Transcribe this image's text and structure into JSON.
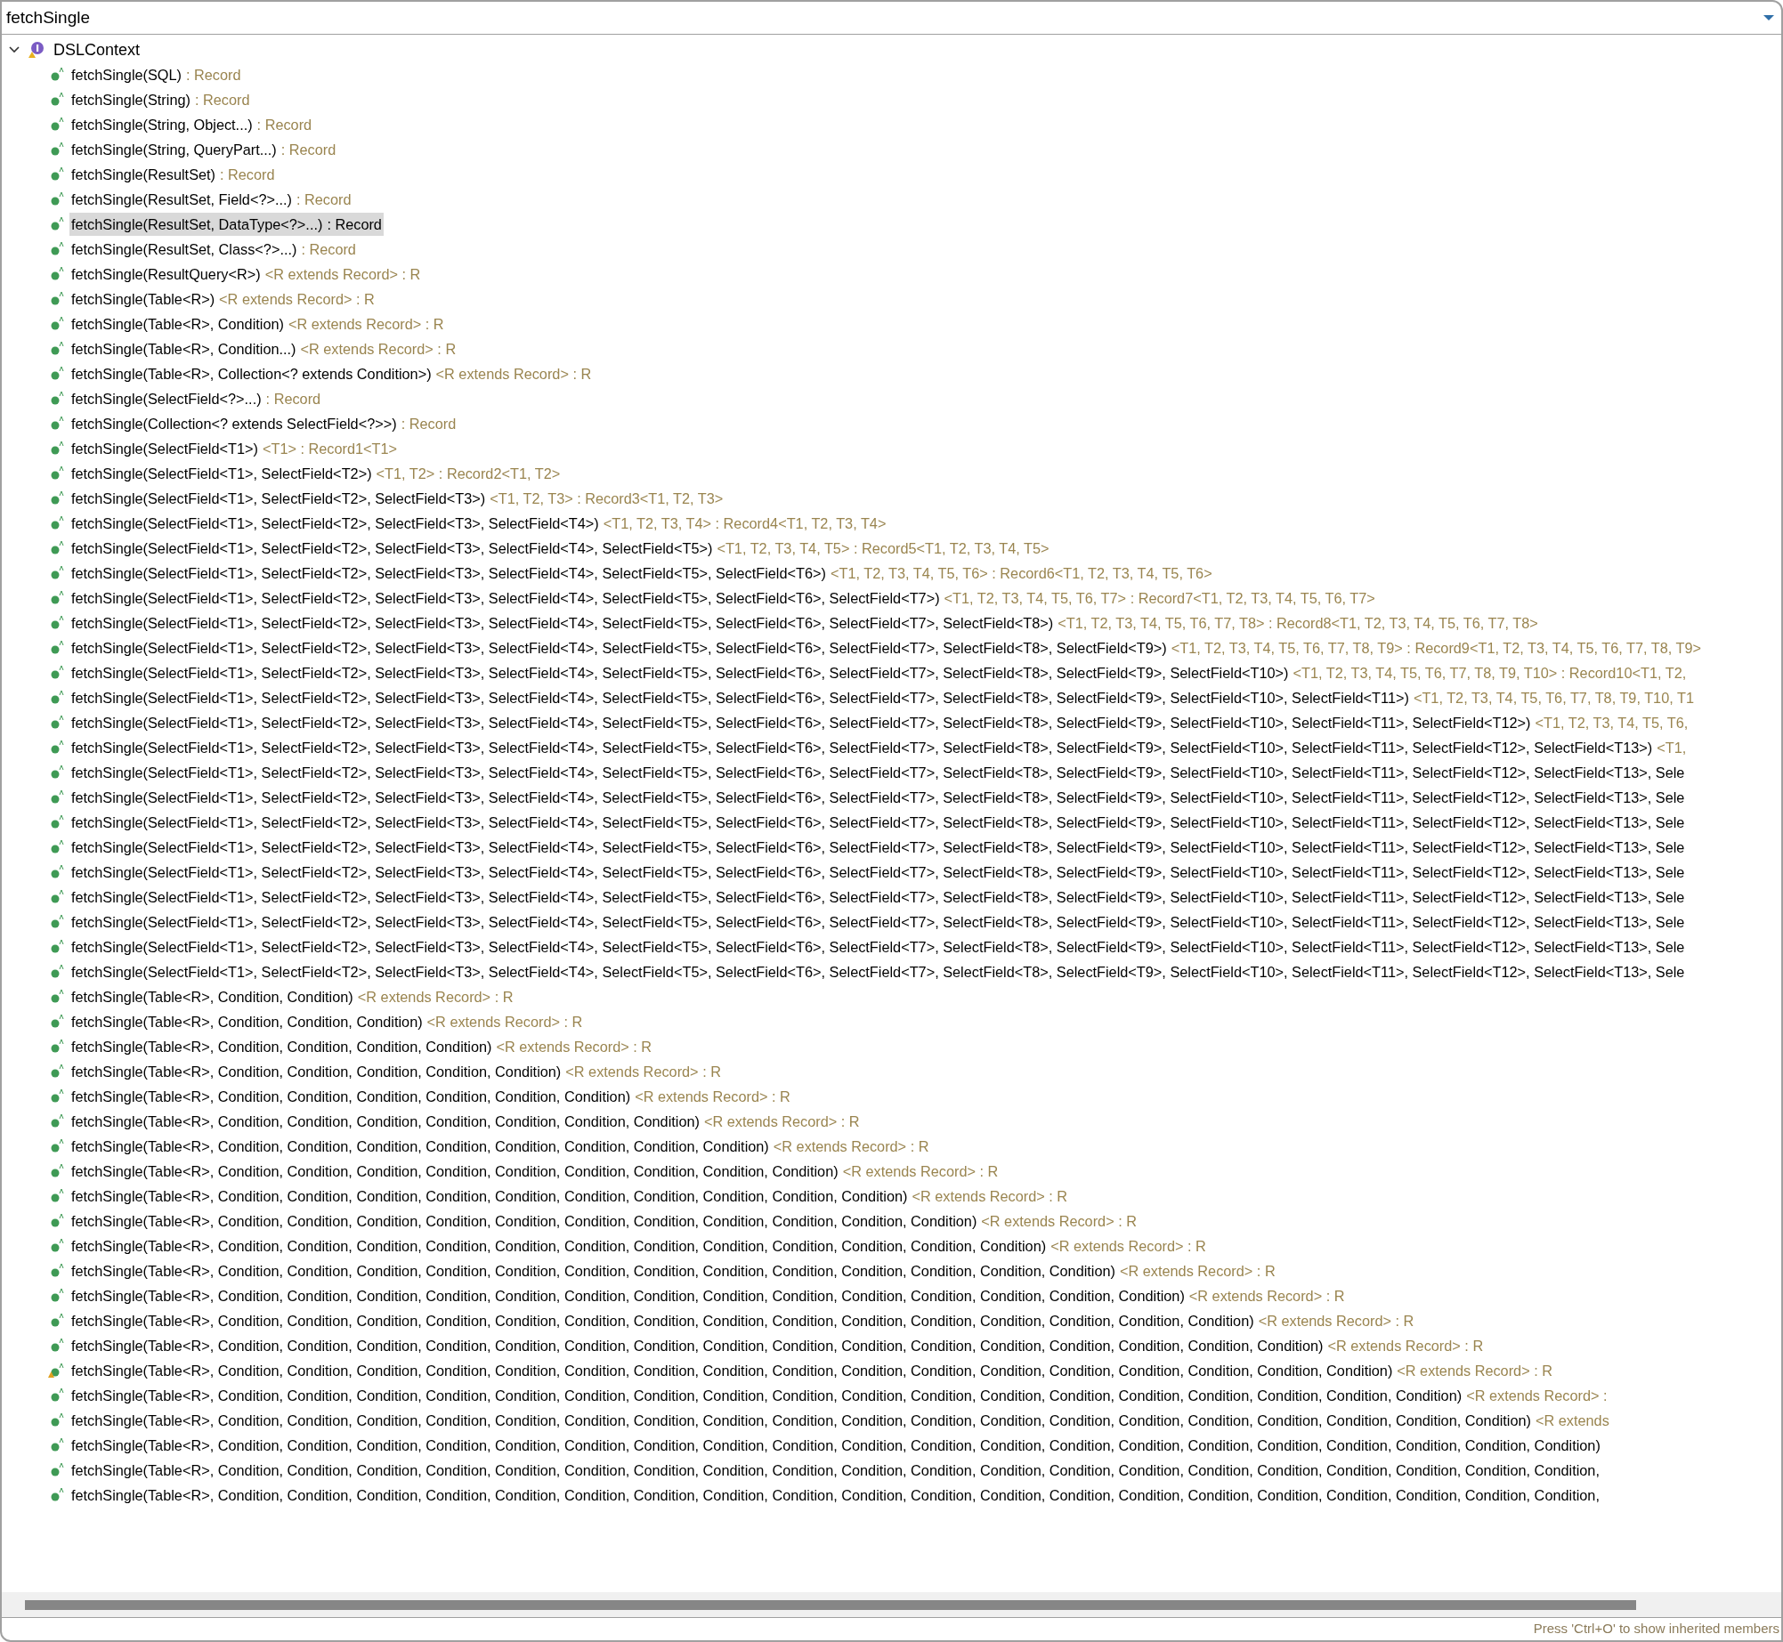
{
  "filter": {
    "value": "fetchSingle"
  },
  "tree": [
    {
      "label": "DSLContext",
      "expanded": true,
      "children": [
        {
          "signature": "fetchSingle(SQL)",
          "return_type": ": Record",
          "selected": false,
          "warning": false
        },
        {
          "signature": "fetchSingle(String)",
          "return_type": ": Record",
          "selected": false,
          "warning": false
        },
        {
          "signature": "fetchSingle(String, Object...)",
          "return_type": ": Record",
          "selected": false,
          "warning": false
        },
        {
          "signature": "fetchSingle(String, QueryPart...)",
          "return_type": ": Record",
          "selected": false,
          "warning": false
        },
        {
          "signature": "fetchSingle(ResultSet)",
          "return_type": ": Record",
          "selected": false,
          "warning": false
        },
        {
          "signature": "fetchSingle(ResultSet, Field<?>...)",
          "return_type": ": Record",
          "selected": false,
          "warning": false
        },
        {
          "signature": "fetchSingle(ResultSet, DataType<?>...)",
          "return_type": ": Record",
          "selected": true,
          "warning": false
        },
        {
          "signature": "fetchSingle(ResultSet, Class<?>...)",
          "return_type": ": Record",
          "selected": false,
          "warning": false
        },
        {
          "signature": "fetchSingle(ResultQuery<R>)",
          "return_type": "<R extends Record> : R",
          "selected": false,
          "warning": false
        },
        {
          "signature": "fetchSingle(Table<R>)",
          "return_type": "<R extends Record> : R",
          "selected": false,
          "warning": false
        },
        {
          "signature": "fetchSingle(Table<R>, Condition)",
          "return_type": "<R extends Record> : R",
          "selected": false,
          "warning": false
        },
        {
          "signature": "fetchSingle(Table<R>, Condition...)",
          "return_type": "<R extends Record> : R",
          "selected": false,
          "warning": false
        },
        {
          "signature": "fetchSingle(Table<R>, Collection<? extends Condition>)",
          "return_type": "<R extends Record> : R",
          "selected": false,
          "warning": false
        },
        {
          "signature": "fetchSingle(SelectField<?>...)",
          "return_type": ": Record",
          "selected": false,
          "warning": false
        },
        {
          "signature": "fetchSingle(Collection<? extends SelectField<?>>)",
          "return_type": ": Record",
          "selected": false,
          "warning": false
        },
        {
          "signature": "fetchSingle(SelectField<T1>)",
          "return_type": "<T1> : Record1<T1>",
          "selected": false,
          "warning": false
        },
        {
          "signature": "fetchSingle(SelectField<T1>, SelectField<T2>)",
          "return_type": "<T1, T2> : Record2<T1, T2>",
          "selected": false,
          "warning": false
        },
        {
          "signature": "fetchSingle(SelectField<T1>, SelectField<T2>, SelectField<T3>)",
          "return_type": "<T1, T2, T3> : Record3<T1, T2, T3>",
          "selected": false,
          "warning": false
        },
        {
          "signature": "fetchSingle(SelectField<T1>, SelectField<T2>, SelectField<T3>, SelectField<T4>)",
          "return_type": "<T1, T2, T3, T4> : Record4<T1, T2, T3, T4>",
          "selected": false,
          "warning": false
        },
        {
          "signature": "fetchSingle(SelectField<T1>, SelectField<T2>, SelectField<T3>, SelectField<T4>, SelectField<T5>)",
          "return_type": "<T1, T2, T3, T4, T5> : Record5<T1, T2, T3, T4, T5>",
          "selected": false,
          "warning": false
        },
        {
          "signature": "fetchSingle(SelectField<T1>, SelectField<T2>, SelectField<T3>, SelectField<T4>, SelectField<T5>, SelectField<T6>)",
          "return_type": "<T1, T2, T3, T4, T5, T6> : Record6<T1, T2, T3, T4, T5, T6>",
          "selected": false,
          "warning": false
        },
        {
          "signature": "fetchSingle(SelectField<T1>, SelectField<T2>, SelectField<T3>, SelectField<T4>, SelectField<T5>, SelectField<T6>, SelectField<T7>)",
          "return_type": "<T1, T2, T3, T4, T5, T6, T7> : Record7<T1, T2, T3, T4, T5, T6, T7>",
          "selected": false,
          "warning": false
        },
        {
          "signature": "fetchSingle(SelectField<T1>, SelectField<T2>, SelectField<T3>, SelectField<T4>, SelectField<T5>, SelectField<T6>, SelectField<T7>, SelectField<T8>)",
          "return_type": "<T1, T2, T3, T4, T5, T6, T7, T8> : Record8<T1, T2, T3, T4, T5, T6, T7, T8>",
          "selected": false,
          "warning": false
        },
        {
          "signature": "fetchSingle(SelectField<T1>, SelectField<T2>, SelectField<T3>, SelectField<T4>, SelectField<T5>, SelectField<T6>, SelectField<T7>, SelectField<T8>, SelectField<T9>)",
          "return_type": "<T1, T2, T3, T4, T5, T6, T7, T8, T9> : Record9<T1, T2, T3, T4, T5, T6, T7, T8, T9>",
          "selected": false,
          "warning": false
        },
        {
          "signature": "fetchSingle(SelectField<T1>, SelectField<T2>, SelectField<T3>, SelectField<T4>, SelectField<T5>, SelectField<T6>, SelectField<T7>, SelectField<T8>, SelectField<T9>, SelectField<T10>)",
          "return_type": "<T1, T2, T3, T4, T5, T6, T7, T8, T9, T10> : Record10<T1, T2,",
          "selected": false,
          "warning": false
        },
        {
          "signature": "fetchSingle(SelectField<T1>, SelectField<T2>, SelectField<T3>, SelectField<T4>, SelectField<T5>, SelectField<T6>, SelectField<T7>, SelectField<T8>, SelectField<T9>, SelectField<T10>, SelectField<T11>)",
          "return_type": "<T1, T2, T3, T4, T5, T6, T7, T8, T9, T10, T1",
          "selected": false,
          "warning": false
        },
        {
          "signature": "fetchSingle(SelectField<T1>, SelectField<T2>, SelectField<T3>, SelectField<T4>, SelectField<T5>, SelectField<T6>, SelectField<T7>, SelectField<T8>, SelectField<T9>, SelectField<T10>, SelectField<T11>, SelectField<T12>)",
          "return_type": "<T1, T2, T3, T4, T5, T6,",
          "selected": false,
          "warning": false
        },
        {
          "signature": "fetchSingle(SelectField<T1>, SelectField<T2>, SelectField<T3>, SelectField<T4>, SelectField<T5>, SelectField<T6>, SelectField<T7>, SelectField<T8>, SelectField<T9>, SelectField<T10>, SelectField<T11>, SelectField<T12>, SelectField<T13>)",
          "return_type": "<T1,",
          "selected": false,
          "warning": false
        },
        {
          "signature": "fetchSingle(SelectField<T1>, SelectField<T2>, SelectField<T3>, SelectField<T4>, SelectField<T5>, SelectField<T6>, SelectField<T7>, SelectField<T8>, SelectField<T9>, SelectField<T10>, SelectField<T11>, SelectField<T12>, SelectField<T13>, Sele",
          "selected": false,
          "warning": false
        },
        {
          "signature": "fetchSingle(SelectField<T1>, SelectField<T2>, SelectField<T3>, SelectField<T4>, SelectField<T5>, SelectField<T6>, SelectField<T7>, SelectField<T8>, SelectField<T9>, SelectField<T10>, SelectField<T11>, SelectField<T12>, SelectField<T13>, Sele",
          "selected": false,
          "warning": false
        },
        {
          "signature": "fetchSingle(SelectField<T1>, SelectField<T2>, SelectField<T3>, SelectField<T4>, SelectField<T5>, SelectField<T6>, SelectField<T7>, SelectField<T8>, SelectField<T9>, SelectField<T10>, SelectField<T11>, SelectField<T12>, SelectField<T13>, Sele",
          "selected": false,
          "warning": false
        },
        {
          "signature": "fetchSingle(SelectField<T1>, SelectField<T2>, SelectField<T3>, SelectField<T4>, SelectField<T5>, SelectField<T6>, SelectField<T7>, SelectField<T8>, SelectField<T9>, SelectField<T10>, SelectField<T11>, SelectField<T12>, SelectField<T13>, Sele",
          "selected": false,
          "warning": false
        },
        {
          "signature": "fetchSingle(SelectField<T1>, SelectField<T2>, SelectField<T3>, SelectField<T4>, SelectField<T5>, SelectField<T6>, SelectField<T7>, SelectField<T8>, SelectField<T9>, SelectField<T10>, SelectField<T11>, SelectField<T12>, SelectField<T13>, Sele",
          "selected": false,
          "warning": false
        },
        {
          "signature": "fetchSingle(SelectField<T1>, SelectField<T2>, SelectField<T3>, SelectField<T4>, SelectField<T5>, SelectField<T6>, SelectField<T7>, SelectField<T8>, SelectField<T9>, SelectField<T10>, SelectField<T11>, SelectField<T12>, SelectField<T13>, Sele",
          "selected": false,
          "warning": false
        },
        {
          "signature": "fetchSingle(SelectField<T1>, SelectField<T2>, SelectField<T3>, SelectField<T4>, SelectField<T5>, SelectField<T6>, SelectField<T7>, SelectField<T8>, SelectField<T9>, SelectField<T10>, SelectField<T11>, SelectField<T12>, SelectField<T13>, Sele",
          "selected": false,
          "warning": false
        },
        {
          "signature": "fetchSingle(SelectField<T1>, SelectField<T2>, SelectField<T3>, SelectField<T4>, SelectField<T5>, SelectField<T6>, SelectField<T7>, SelectField<T8>, SelectField<T9>, SelectField<T10>, SelectField<T11>, SelectField<T12>, SelectField<T13>, Sele",
          "selected": false,
          "warning": false
        },
        {
          "signature": "fetchSingle(SelectField<T1>, SelectField<T2>, SelectField<T3>, SelectField<T4>, SelectField<T5>, SelectField<T6>, SelectField<T7>, SelectField<T8>, SelectField<T9>, SelectField<T10>, SelectField<T11>, SelectField<T12>, SelectField<T13>, Sele",
          "selected": false,
          "warning": false
        },
        {
          "signature": "fetchSingle(Table<R>, Condition, Condition)",
          "return_type": "<R extends Record> : R",
          "selected": false,
          "warning": false
        },
        {
          "signature": "fetchSingle(Table<R>, Condition, Condition, Condition)",
          "return_type": "<R extends Record> : R",
          "selected": false,
          "warning": false
        },
        {
          "signature": "fetchSingle(Table<R>, Condition, Condition, Condition, Condition)",
          "return_type": "<R extends Record> : R",
          "selected": false,
          "warning": false
        },
        {
          "signature": "fetchSingle(Table<R>, Condition, Condition, Condition, Condition, Condition)",
          "return_type": "<R extends Record> : R",
          "selected": false,
          "warning": false
        },
        {
          "signature": "fetchSingle(Table<R>, Condition, Condition, Condition, Condition, Condition, Condition)",
          "return_type": "<R extends Record> : R",
          "selected": false,
          "warning": false
        },
        {
          "signature": "fetchSingle(Table<R>, Condition, Condition, Condition, Condition, Condition, Condition, Condition)",
          "return_type": "<R extends Record> : R",
          "selected": false,
          "warning": false
        },
        {
          "signature": "fetchSingle(Table<R>, Condition, Condition, Condition, Condition, Condition, Condition, Condition, Condition)",
          "return_type": "<R extends Record> : R",
          "selected": false,
          "warning": false
        },
        {
          "signature": "fetchSingle(Table<R>, Condition, Condition, Condition, Condition, Condition, Condition, Condition, Condition, Condition)",
          "return_type": "<R extends Record> : R",
          "selected": false,
          "warning": false
        },
        {
          "signature": "fetchSingle(Table<R>, Condition, Condition, Condition, Condition, Condition, Condition, Condition, Condition, Condition, Condition)",
          "return_type": "<R extends Record> : R",
          "selected": false,
          "warning": false
        },
        {
          "signature": "fetchSingle(Table<R>, Condition, Condition, Condition, Condition, Condition, Condition, Condition, Condition, Condition, Condition, Condition)",
          "return_type": "<R extends Record> : R",
          "selected": false,
          "warning": false
        },
        {
          "signature": "fetchSingle(Table<R>, Condition, Condition, Condition, Condition, Condition, Condition, Condition, Condition, Condition, Condition, Condition, Condition)",
          "return_type": "<R extends Record> : R",
          "selected": false,
          "warning": false
        },
        {
          "signature": "fetchSingle(Table<R>, Condition, Condition, Condition, Condition, Condition, Condition, Condition, Condition, Condition, Condition, Condition, Condition, Condition)",
          "return_type": "<R extends Record> : R",
          "selected": false,
          "warning": false
        },
        {
          "signature": "fetchSingle(Table<R>, Condition, Condition, Condition, Condition, Condition, Condition, Condition, Condition, Condition, Condition, Condition, Condition, Condition, Condition)",
          "return_type": "<R extends Record> : R",
          "selected": false,
          "warning": false
        },
        {
          "signature": "fetchSingle(Table<R>, Condition, Condition, Condition, Condition, Condition, Condition, Condition, Condition, Condition, Condition, Condition, Condition, Condition, Condition, Condition)",
          "return_type": "<R extends Record> : R",
          "selected": false,
          "warning": false
        },
        {
          "signature": "fetchSingle(Table<R>, Condition, Condition, Condition, Condition, Condition, Condition, Condition, Condition, Condition, Condition, Condition, Condition, Condition, Condition, Condition, Condition)",
          "return_type": "<R extends Record> : R",
          "selected": false,
          "warning": false
        },
        {
          "signature": "fetchSingle(Table<R>, Condition, Condition, Condition, Condition, Condition, Condition, Condition, Condition, Condition, Condition, Condition, Condition, Condition, Condition, Condition, Condition, Condition)",
          "return_type": "<R extends Record> : R",
          "selected": false,
          "warning": true
        },
        {
          "signature": "fetchSingle(Table<R>, Condition, Condition, Condition, Condition, Condition, Condition, Condition, Condition, Condition, Condition, Condition, Condition, Condition, Condition, Condition, Condition, Condition, Condition)",
          "return_type": "<R extends Record> :",
          "selected": false,
          "warning": false
        },
        {
          "signature": "fetchSingle(Table<R>, Condition, Condition, Condition, Condition, Condition, Condition, Condition, Condition, Condition, Condition, Condition, Condition, Condition, Condition, Condition, Condition, Condition, Condition, Condition)",
          "return_type": "<R extends",
          "selected": false,
          "warning": false
        },
        {
          "signature": "fetchSingle(Table<R>, Condition, Condition, Condition, Condition, Condition, Condition, Condition, Condition, Condition, Condition, Condition, Condition, Condition, Condition, Condition, Condition, Condition, Condition, Condition, Condition)",
          "selected": false,
          "warning": false
        },
        {
          "signature": "fetchSingle(Table<R>, Condition, Condition, Condition, Condition, Condition, Condition, Condition, Condition, Condition, Condition, Condition, Condition, Condition, Condition, Condition, Condition, Condition, Condition, Condition, Condition,",
          "selected": false,
          "warning": false
        },
        {
          "signature": "fetchSingle(Table<R>, Condition, Condition, Condition, Condition, Condition, Condition, Condition, Condition, Condition, Condition, Condition, Condition, Condition, Condition, Condition, Condition, Condition, Condition, Condition, Condition,",
          "selected": false,
          "warning": false
        }
      ]
    }
  ],
  "status_bar": {
    "hint": "Press 'Ctrl+O' to show inherited members"
  }
}
